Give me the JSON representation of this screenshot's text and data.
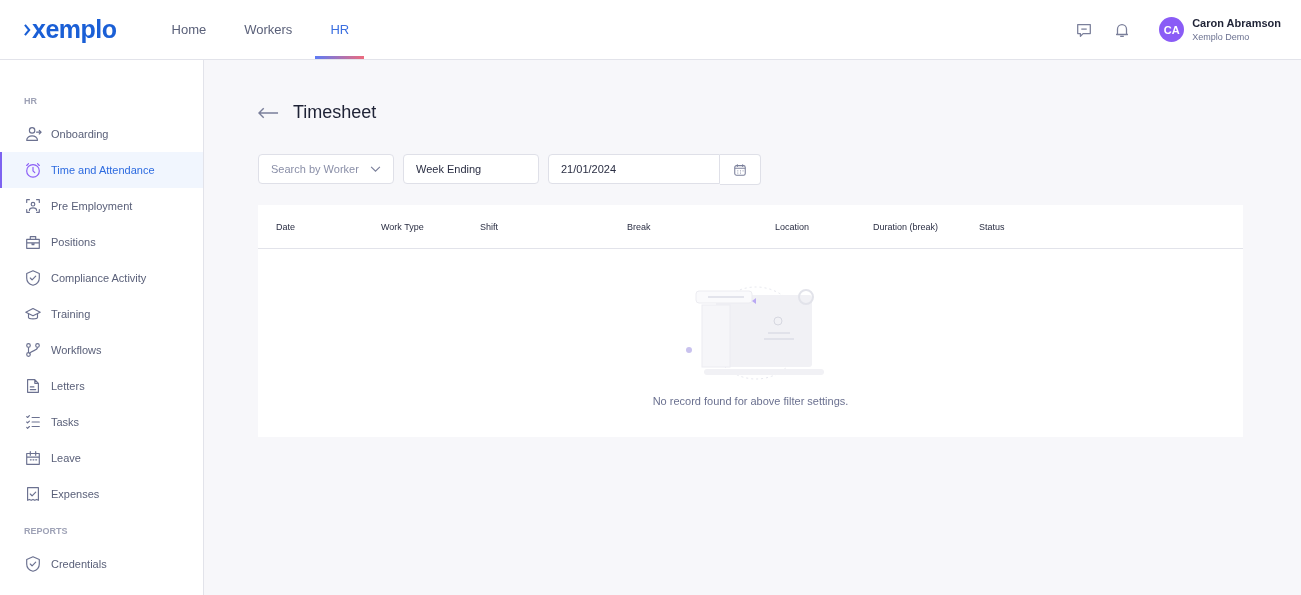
{
  "logo": {
    "text": "xemplo"
  },
  "nav": [
    {
      "label": "Home",
      "selected": false
    },
    {
      "label": "Workers",
      "selected": false
    },
    {
      "label": "HR",
      "selected": true
    }
  ],
  "user": {
    "initials": "CA",
    "name": "Caron Abramson",
    "org": "Xemplo Demo"
  },
  "sidebar": {
    "sections": [
      {
        "title": "HR",
        "items": [
          {
            "label": "Onboarding",
            "selected": false
          },
          {
            "label": "Time and Attendance",
            "selected": true
          },
          {
            "label": "Pre Employment",
            "selected": false
          },
          {
            "label": "Positions",
            "selected": false
          },
          {
            "label": "Compliance Activity",
            "selected": false
          },
          {
            "label": "Training",
            "selected": false
          },
          {
            "label": "Workflows",
            "selected": false
          },
          {
            "label": "Letters",
            "selected": false
          },
          {
            "label": "Tasks",
            "selected": false
          },
          {
            "label": "Leave",
            "selected": false
          },
          {
            "label": "Expenses",
            "selected": false
          }
        ]
      },
      {
        "title": "REPORTS",
        "items": [
          {
            "label": "Credentials",
            "selected": false
          }
        ]
      }
    ]
  },
  "page": {
    "title": "Timesheet"
  },
  "filters": {
    "worker": {
      "placeholder": "Search by Worker"
    },
    "period": {
      "value": "Week Ending"
    },
    "date": {
      "value": "21/01/2024"
    }
  },
  "table": {
    "columns": [
      "Date",
      "Work Type",
      "Shift",
      "Break",
      "Location",
      "Duration (break)",
      "Status"
    ],
    "empty_message": "No record found for above filter settings."
  }
}
